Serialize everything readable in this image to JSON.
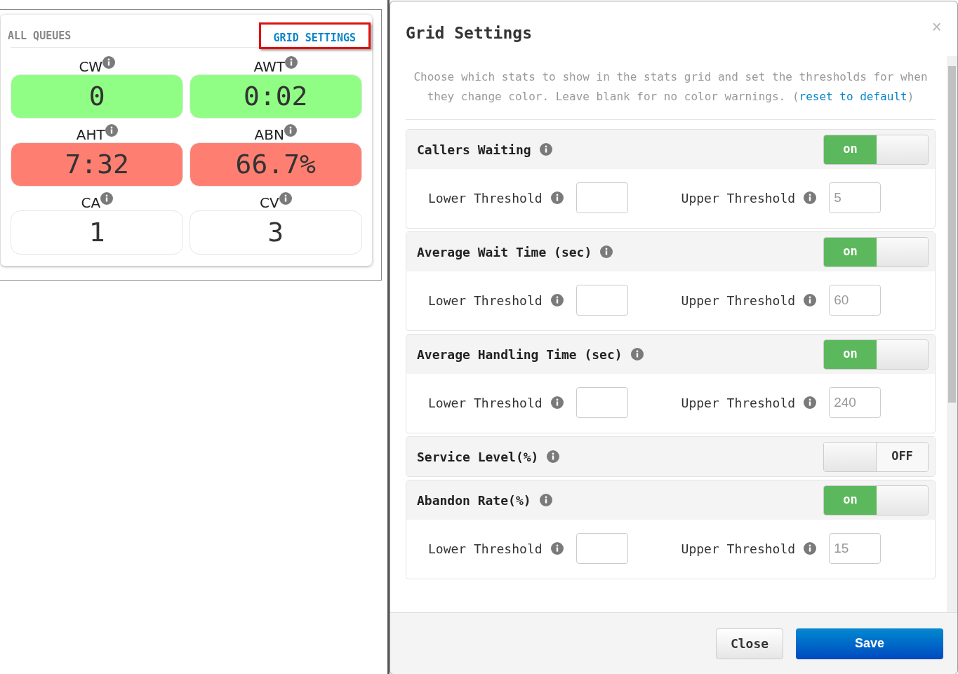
{
  "queues_panel": {
    "title": "ALL QUEUES",
    "settings_link": "GRID SETTINGS",
    "stats": [
      {
        "label": "CW",
        "value": "0",
        "color": "#90fe84"
      },
      {
        "label": "AWT",
        "value": "0:02",
        "color": "#90fe84"
      },
      {
        "label": "AHT",
        "value": "7:32",
        "color": "#fe7f72"
      },
      {
        "label": "ABN",
        "value": "66.7%",
        "color": "#fe7f72"
      },
      {
        "label": "CA",
        "value": "1",
        "color": "#ffffff"
      },
      {
        "label": "CV",
        "value": "3",
        "color": "#ffffff"
      }
    ]
  },
  "dialog": {
    "title": "Grid Settings",
    "close_symbol": "×",
    "intro": "Choose which stats to show in the stats grid and set the thresholds for when they change color. Leave blank for no color warnings. (",
    "intro_link": "reset to default",
    "intro_end": ")",
    "settings": [
      {
        "name": "Callers Waiting",
        "on": true,
        "toggle_label": "on",
        "lower_label": "Lower Threshold",
        "upper_label": "Upper Threshold",
        "upper_placeholder": "5"
      },
      {
        "name": "Average Wait Time (sec)",
        "on": true,
        "toggle_label": "on",
        "lower_label": "Lower Threshold",
        "upper_label": "Upper Threshold",
        "upper_placeholder": "60"
      },
      {
        "name": "Average Handling Time (sec)",
        "on": true,
        "toggle_label": "on",
        "lower_label": "Lower Threshold",
        "upper_label": "Upper Threshold",
        "upper_placeholder": "240"
      },
      {
        "name": "Service Level(%)",
        "on": false,
        "toggle_label": "OFF"
      },
      {
        "name": "Abandon Rate(%)",
        "on": true,
        "toggle_label": "on",
        "lower_label": "Lower Threshold",
        "upper_label": "Upper Threshold",
        "upper_placeholder": "15"
      }
    ],
    "buttons": [
      {
        "label": "Close",
        "kind": "secondary"
      },
      {
        "label": "Save",
        "kind": "primary"
      }
    ]
  }
}
